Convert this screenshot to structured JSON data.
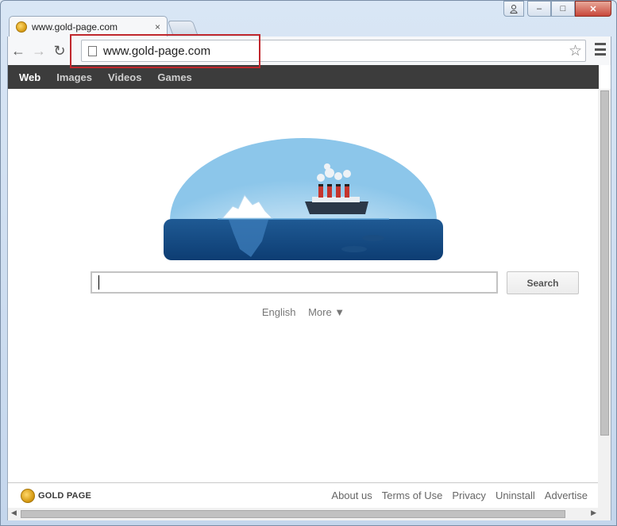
{
  "browser": {
    "tab_title": "www.gold-page.com",
    "tab_close": "×",
    "url": "www.gold-page.com",
    "back_icon": "←",
    "forward_icon": "→",
    "reload_icon": "↻",
    "star_icon": "☆",
    "window_min": "–",
    "window_max": "□",
    "window_close": "✕"
  },
  "colors": {
    "nav_bg": "#3c3c3c",
    "highlight_box": "#c0272d",
    "gold": "#d69a12"
  },
  "topnav": {
    "items": [
      "Web",
      "Images",
      "Videos",
      "Games"
    ],
    "active": "Web"
  },
  "search": {
    "value": "",
    "button_label": "Search"
  },
  "language": {
    "current": "English",
    "more": "More ▼"
  },
  "footer": {
    "logo_text": "GOLD PAGE",
    "links": [
      "About us",
      "Terms of Use",
      "Privacy",
      "Uninstall",
      "Advertise"
    ]
  }
}
